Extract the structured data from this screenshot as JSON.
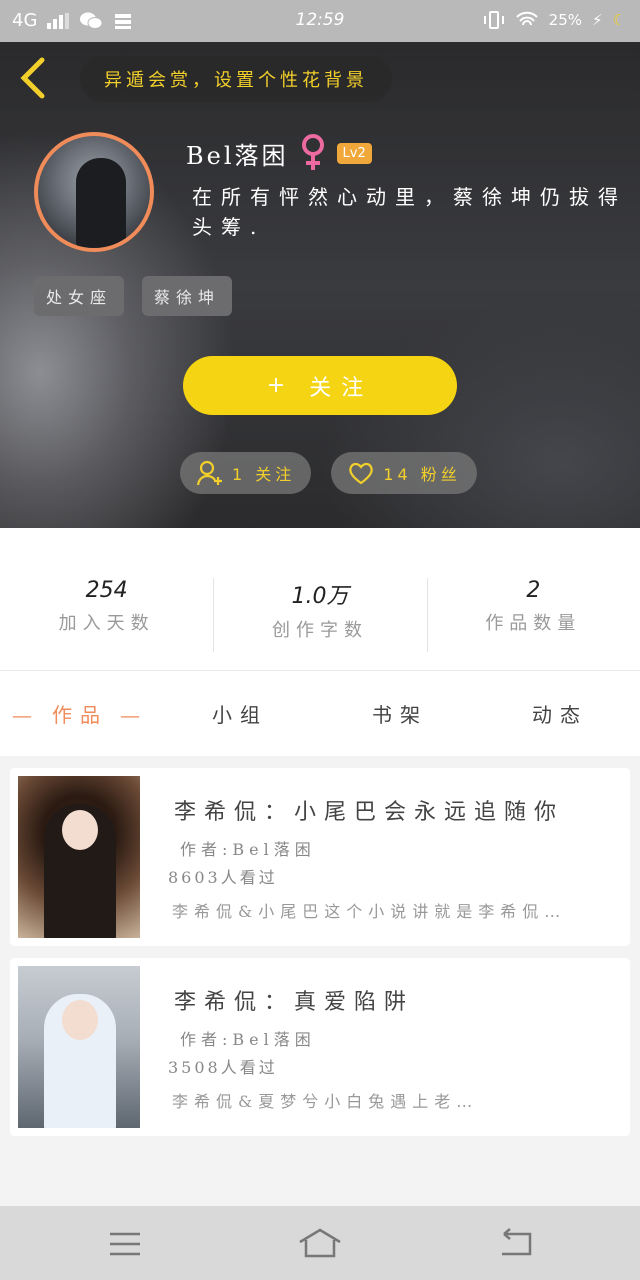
{
  "status_bar": {
    "network": "4G",
    "time": "12:59",
    "battery": "25%"
  },
  "header": {
    "banner": "异遁会赏，设置个性花背景",
    "username": "Bel落困",
    "level": "Lv2",
    "bio": "在所有怦然心动里，蔡徐坤仍拔得头筹.",
    "tags": [
      "处女座",
      "蔡徐坤"
    ],
    "follow_label": "关注",
    "follow_icon": "+",
    "following": "1 关注",
    "fans": "14 粉丝"
  },
  "stats": [
    {
      "value": "254",
      "label": "加入天数"
    },
    {
      "value": "1.0万",
      "label": "创作字数"
    },
    {
      "value": "2",
      "label": "作品数量"
    }
  ],
  "tabs": [
    "作品",
    "小组",
    "书架",
    "动态"
  ],
  "works": [
    {
      "title": "李希侃：小尾巴会永远追随你",
      "author": "作者:Bel落困",
      "views": "8603人看过",
      "desc": "李希侃&小尾巴这个小说讲就是李希侃…"
    },
    {
      "title": "李希侃：真爱陷阱",
      "author": "作者:Bel落困",
      "views": "3508人看过",
      "desc": "李希侃&夏梦兮小白兔遇上老…"
    }
  ],
  "colors": {
    "accent_yellow": "#f5d413",
    "accent_orange": "#f08b5a",
    "gender_pink": "#ec6aa0"
  }
}
